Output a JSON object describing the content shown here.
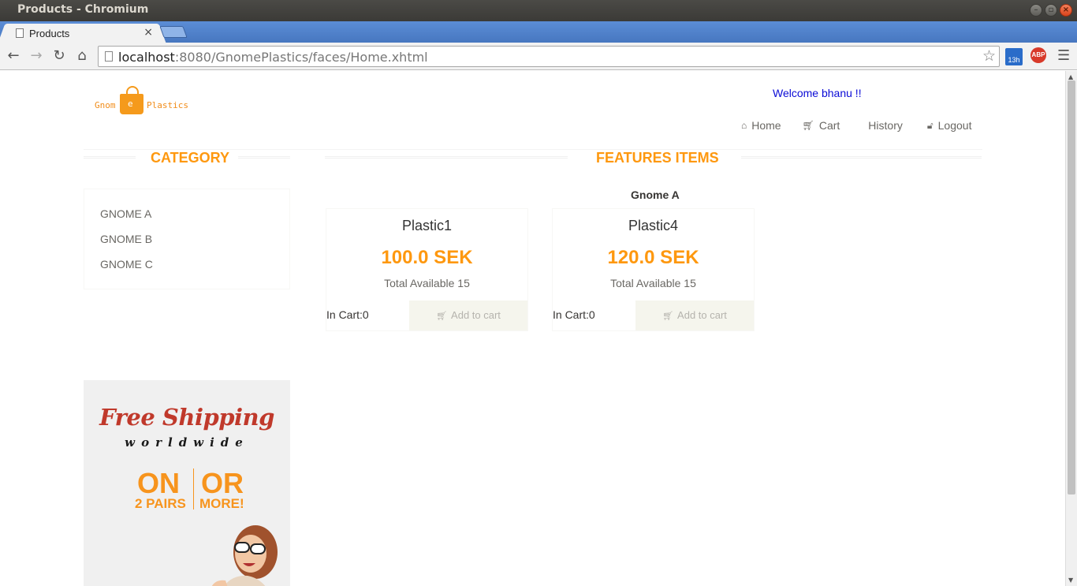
{
  "window": {
    "title": "Products - Chromium"
  },
  "tabs": [
    {
      "label": "Products",
      "close": "×"
    }
  ],
  "address_bar": {
    "host": "localhost",
    "path": ":8080/GnomePlastics/faces/Home.xhtml"
  },
  "extensions": {
    "calendar_badge": "13h",
    "adblock": "ABP"
  },
  "logo": {
    "left": "Gnom",
    "middle": "e",
    "right": "Plastics"
  },
  "header": {
    "welcome": "Welcome bhanu !!",
    "nav": [
      {
        "label": "Home",
        "icon": "home-icon"
      },
      {
        "label": "Cart",
        "icon": "cart-icon"
      },
      {
        "label": "History",
        "icon": ""
      },
      {
        "label": "Logout",
        "icon": "unlock-icon"
      }
    ]
  },
  "sidebar": {
    "title": "CATEGORY",
    "categories": [
      "GNOME A",
      "GNOME B",
      "GNOME C"
    ]
  },
  "main": {
    "title": "FEATURES ITEMS",
    "group_label": "Gnome A",
    "products": [
      {
        "name": "Plastic1",
        "price": "100.0 SEK",
        "availability": "Total Available 15",
        "in_cart": "In Cart:0",
        "button": "Add to cart"
      },
      {
        "name": "Plastic4",
        "price": "120.0 SEK",
        "availability": "Total Available 15",
        "in_cart": "In Cart:0",
        "button": "Add to cart"
      }
    ]
  },
  "banner": {
    "headline": "Free Shipping",
    "subline": "worldwide",
    "on": "ON",
    "or": "OR",
    "pairs": "2 PAIRS",
    "more": "MORE!"
  },
  "colors": {
    "accent": "#fe980f",
    "welcome": "#0b0bd6",
    "text": "#696763",
    "tabstrip": "#4f81c9"
  }
}
